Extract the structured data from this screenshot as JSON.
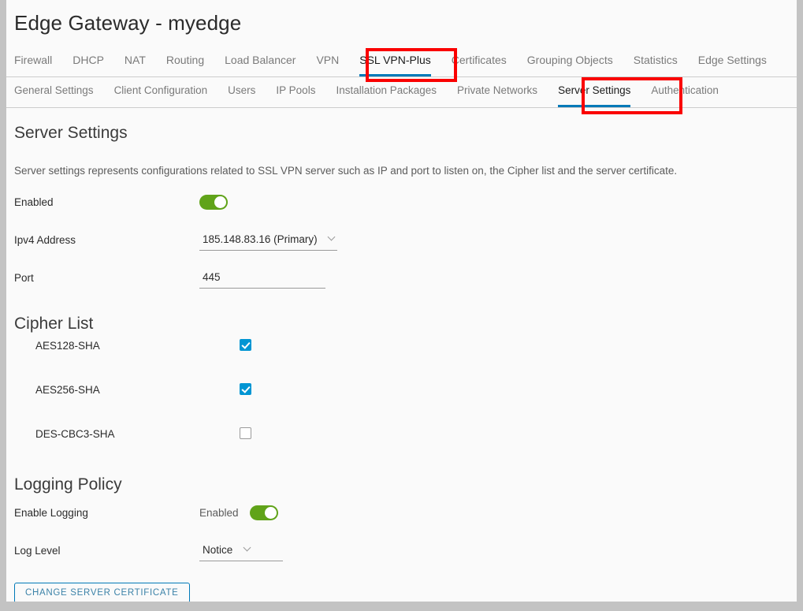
{
  "header": {
    "title": "Edge Gateway - myedge"
  },
  "primary_tabs": [
    {
      "label": "Firewall",
      "active": false
    },
    {
      "label": "DHCP",
      "active": false
    },
    {
      "label": "NAT",
      "active": false
    },
    {
      "label": "Routing",
      "active": false
    },
    {
      "label": "Load Balancer",
      "active": false
    },
    {
      "label": "VPN",
      "active": false
    },
    {
      "label": "SSL VPN-Plus",
      "active": true
    },
    {
      "label": "Certificates",
      "active": false
    },
    {
      "label": "Grouping Objects",
      "active": false
    },
    {
      "label": "Statistics",
      "active": false
    },
    {
      "label": "Edge Settings",
      "active": false
    }
  ],
  "secondary_tabs": [
    {
      "label": "General Settings",
      "active": false
    },
    {
      "label": "Client Configuration",
      "active": false
    },
    {
      "label": "Users",
      "active": false
    },
    {
      "label": "IP Pools",
      "active": false
    },
    {
      "label": "Installation Packages",
      "active": false
    },
    {
      "label": "Private Networks",
      "active": false
    },
    {
      "label": "Server Settings",
      "active": true
    },
    {
      "label": "Authentication",
      "active": false
    }
  ],
  "main": {
    "heading": "Server Settings",
    "description": "Server settings represents configurations related to SSL VPN server such as IP and port to listen on, the Cipher list and the server certificate.",
    "enabled": {
      "label": "Enabled",
      "value": true
    },
    "ipv4": {
      "label": "Ipv4 Address",
      "value": "185.148.83.16 (Primary)"
    },
    "port": {
      "label": "Port",
      "value": "445"
    },
    "cipher_list": {
      "heading": "Cipher List",
      "items": [
        {
          "label": "AES128-SHA",
          "checked": true
        },
        {
          "label": "AES256-SHA",
          "checked": true
        },
        {
          "label": "DES-CBC3-SHA",
          "checked": false
        }
      ]
    },
    "logging": {
      "heading": "Logging Policy",
      "enable_logging": {
        "label": "Enable Logging",
        "state_text": "Enabled",
        "value": true
      },
      "log_level": {
        "label": "Log Level",
        "value": "Notice"
      }
    },
    "change_certificate_button": "CHANGE SERVER CERTIFICATE"
  },
  "colors": {
    "accent_blue": "#0079b8",
    "checkbox_blue": "#0095d3",
    "toggle_green": "#60a319",
    "annotation_red": "#fa0000"
  }
}
